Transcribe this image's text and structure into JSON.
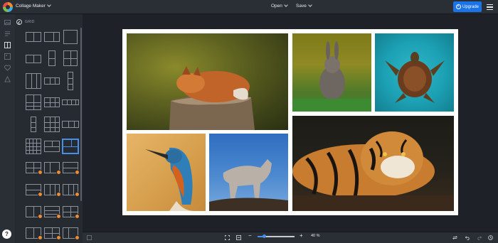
{
  "header": {
    "app_title": "Collage Maker",
    "menu_open": "Open",
    "menu_save": "Save",
    "upgrade_label": "Upgrade"
  },
  "icon_rail": {
    "items": [
      "image-icon",
      "text-icon",
      "layout-icon",
      "photo-gallery-icon",
      "heart-icon",
      "shapes-icon"
    ],
    "help_label": "?"
  },
  "panel": {
    "title": "GRID"
  },
  "canvas": {
    "photos": [
      {
        "subject": "sleeping fox on tree stump"
      },
      {
        "subject": "rabbit in grass"
      },
      {
        "subject": "sea turtle"
      },
      {
        "subject": "kingfisher"
      },
      {
        "subject": "wolf"
      },
      {
        "subject": "tiger lying down"
      }
    ]
  },
  "footer": {
    "zoom_minus": "−",
    "zoom_plus": "+",
    "zoom_label": "40 %",
    "zoom_level": 0.2
  },
  "colors": {
    "accent": "#1a73e8",
    "premium_badge": "#f28b30"
  }
}
